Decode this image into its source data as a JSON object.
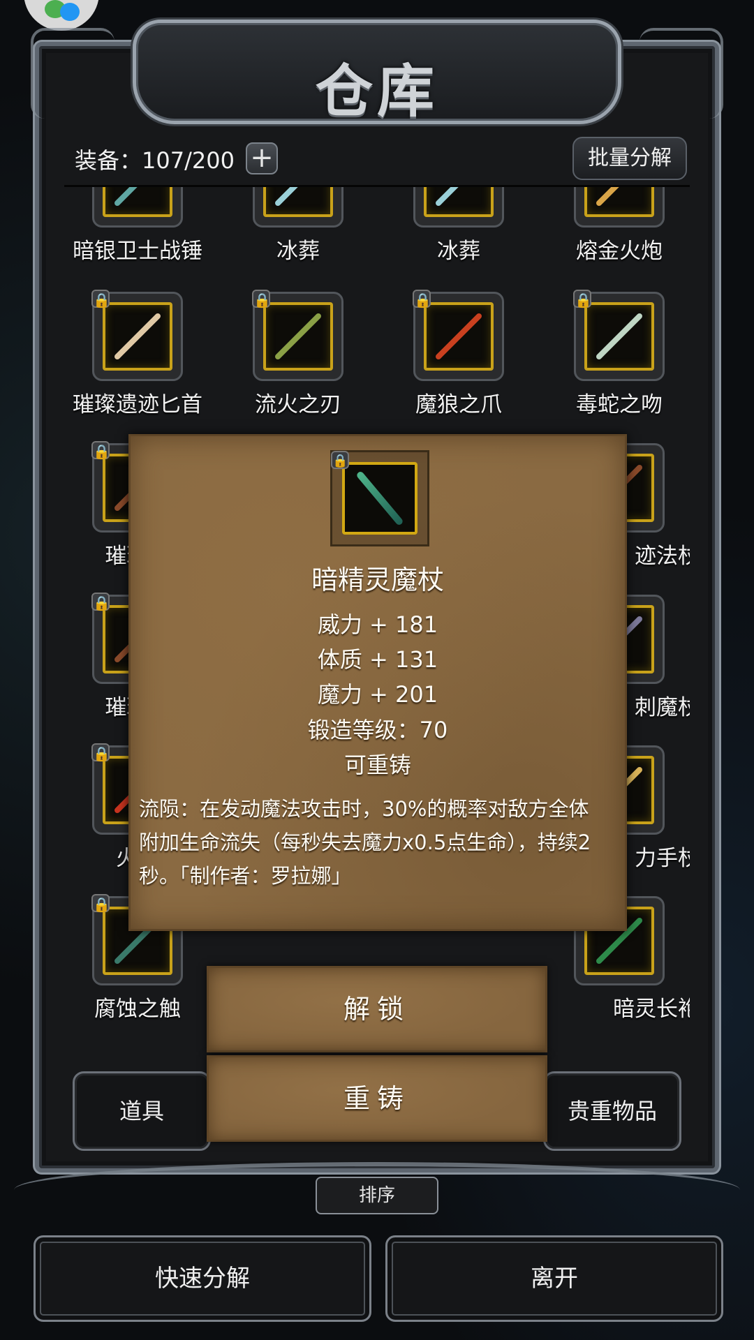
{
  "title": "仓库",
  "equip_label": "装备：107/200",
  "plus_symbol": "+",
  "bulk_button": "批量分解",
  "grid_items": [
    {
      "name": "暗银卫士战锤",
      "locked": false,
      "color": "#5fa7a3"
    },
    {
      "name": "冰葬",
      "locked": false,
      "color": "#9ad0d8"
    },
    {
      "name": "冰葬",
      "locked": false,
      "color": "#9ad0d8"
    },
    {
      "name": "熔金火炮",
      "locked": false,
      "color": "#d9a548"
    },
    {
      "name": "璀璨遗迹匕首",
      "locked": true,
      "color": "#e0c9a5"
    },
    {
      "name": "流火之刃",
      "locked": true,
      "color": "#8aa046"
    },
    {
      "name": "魔狼之爪",
      "locked": true,
      "color": "#c9401f"
    },
    {
      "name": "毒蛇之吻",
      "locked": true,
      "color": "#bfd6c4"
    },
    {
      "name": "璀璨遗",
      "locked": true,
      "color": "#8a4a2a"
    },
    {
      "name": "迹法杖",
      "locked": false,
      "color": "#8a4a2a"
    },
    {
      "name": "璀璨遗",
      "locked": true,
      "color": "#8a4a2a"
    },
    {
      "name": "刺魔杖",
      "locked": false,
      "color": "#7d7a9a"
    },
    {
      "name": "火元",
      "locked": true,
      "color": "#c8341f"
    },
    {
      "name": "力手杖",
      "locked": false,
      "color": "#d9b45a"
    },
    {
      "name": "腐蚀之触",
      "locked": true,
      "color": "#3a7a6a"
    },
    {
      "name": "暗灵长袍",
      "locked": false,
      "color": "#2e8a4a"
    }
  ],
  "popup": {
    "item_name": "暗精灵魔杖",
    "stats": [
      "威力 + 181",
      "体质 + 131",
      "魔力 + 201",
      "锻造等级：70",
      "可重铸"
    ],
    "description": "流陨：在发动魔法攻击时，30%的概率对敌方全体附加生命流失（每秒失去魔力x0.5点生命），持续2秒。「制作者：罗拉娜」",
    "unlock_button": "解锁",
    "reforge_button": "重铸"
  },
  "tabs": {
    "items": "道具",
    "valuables": "贵重物品"
  },
  "sort_button": "排序",
  "quick_disassemble_button": "快速分解",
  "leave_button": "离开"
}
